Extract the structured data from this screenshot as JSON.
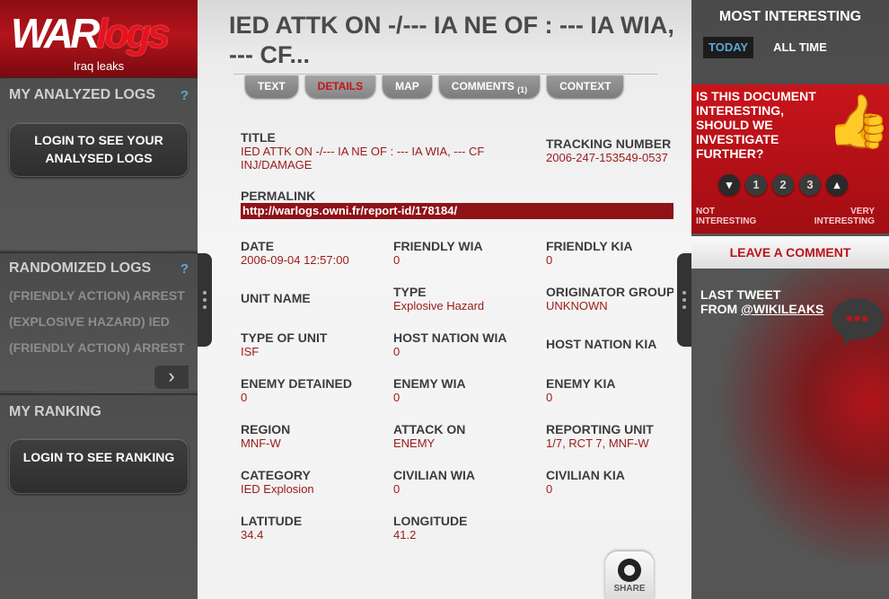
{
  "logo": {
    "part1": "WAR",
    "part2": "logs",
    "subtitle": "Iraq leaks"
  },
  "left": {
    "analyzed": {
      "heading": "MY ANALYZED LOGS",
      "help": "?",
      "button": "LOGIN TO SEE YOUR ANALYSED LOGS"
    },
    "randomized": {
      "heading": "RANDOMIZED LOGS",
      "help": "?",
      "items": [
        "(FRIENDLY ACTION) ARREST",
        "(EXPLOSIVE HAZARD) IED",
        "(FRIENDLY ACTION) ARREST"
      ],
      "next_icon": "chevron-right-icon"
    },
    "ranking": {
      "heading": "MY RANKING",
      "button": "LOGIN TO SEE RANKING"
    }
  },
  "main": {
    "title": "IED ATTK ON -/--- IA NE OF : --- IA WIA, --- CF...",
    "tabs": [
      {
        "label": "TEXT"
      },
      {
        "label": "DETAILS",
        "active": true
      },
      {
        "label": "MAP"
      },
      {
        "label": "COMMENTS",
        "count": "(1)"
      },
      {
        "label": "CONTEXT"
      }
    ],
    "fields": {
      "title": {
        "label": "TITLE",
        "value": "IED ATTK ON -/--- IA NE OF : --- IA WIA, --- CF INJ/DAMAGE"
      },
      "tracking": {
        "label": "TRACKING NUMBER",
        "value": "2006-247-153549-0537"
      },
      "permalink": {
        "label": "PERMALINK",
        "value": "http://warlogs.owni.fr/report-id/178184/"
      },
      "date": {
        "label": "DATE",
        "value": "2006-09-04 12:57:00"
      },
      "friendly_wia": {
        "label": "FRIENDLY WIA",
        "value": "0"
      },
      "friendly_kia": {
        "label": "FRIENDLY KIA",
        "value": "0"
      },
      "unit_name": {
        "label": "UNIT NAME",
        "value": ""
      },
      "type": {
        "label": "TYPE",
        "value": "Explosive Hazard"
      },
      "originator": {
        "label": "ORIGINATOR GROUP",
        "value": "UNKNOWN"
      },
      "type_of_unit": {
        "label": "TYPE OF UNIT",
        "value": "ISF"
      },
      "host_wia": {
        "label": "HOST NATION WIA",
        "value": "0"
      },
      "host_kia": {
        "label": "HOST NATION KIA",
        "value": ""
      },
      "enemy_detained": {
        "label": "ENEMY DETAINED",
        "value": "0"
      },
      "enemy_wia": {
        "label": "ENEMY WIA",
        "value": "0"
      },
      "enemy_kia": {
        "label": "ENEMY KIA",
        "value": "0"
      },
      "region": {
        "label": "REGION",
        "value": "MNF-W"
      },
      "attack_on": {
        "label": "ATTACK ON",
        "value": "ENEMY"
      },
      "reporting_unit": {
        "label": "REPORTING UNIT",
        "value": "1/7, RCT 7, MNF-W"
      },
      "category": {
        "label": "CATEGORY",
        "value": "IED Explosion"
      },
      "civilian_wia": {
        "label": "CIVILIAN WIA",
        "value": "0"
      },
      "civilian_kia": {
        "label": "CIVILIAN KIA",
        "value": "0"
      },
      "latitude": {
        "label": "LATITUDE",
        "value": "34.4"
      },
      "longitude": {
        "label": "LONGITUDE",
        "value": "41.2"
      }
    },
    "share_label": "SHARE"
  },
  "right": {
    "most_interesting": {
      "heading": "MOST INTERESTING",
      "tabs": [
        {
          "label": "TODAY",
          "active": true
        },
        {
          "label": "ALL TIME"
        }
      ]
    },
    "interest": {
      "question": "IS THIS DOCUMENT INTERESTING, SHOULD WE INVESTIGATE FURTHER?",
      "votes": [
        "1",
        "2",
        "3"
      ],
      "low_label_1": "NOT",
      "low_label_2": "INTERESTING",
      "high_label_1": "VERY",
      "high_label_2": "INTERESTING"
    },
    "leave_comment": "LEAVE A COMMENT",
    "tweet": {
      "line1": "LAST TWEET",
      "line2": "FROM ",
      "handle": "@WIKILEAKS"
    }
  }
}
